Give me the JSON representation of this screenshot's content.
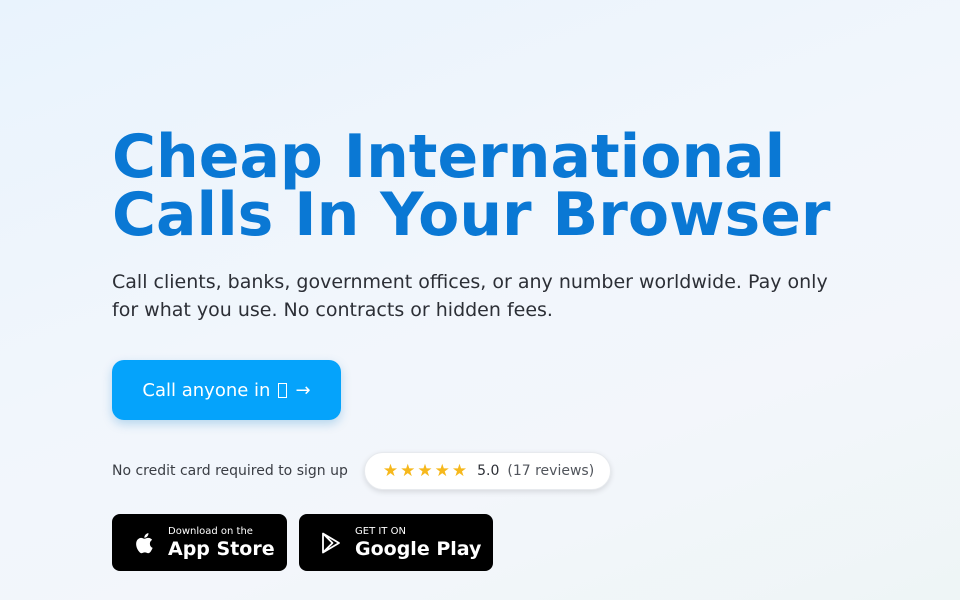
{
  "hero": {
    "title_line1": "Cheap International",
    "title_line2": "Calls In Your Browser",
    "subtitle": "Call clients, banks, government offices, or any number worldwide. Pay only for what you use. No contracts or hidden fees."
  },
  "cta": {
    "label": "Call anyone in",
    "arrow": "→"
  },
  "signup_note": "No credit card required to sign up",
  "rating": {
    "stars": 5,
    "star_glyph": "★",
    "score": "5.0",
    "reviews": "(17 reviews)"
  },
  "stores": {
    "apple": {
      "small": "Download on the",
      "big": "App Store",
      "icon": "apple-icon"
    },
    "google": {
      "small": "GET IT ON",
      "big": "Google Play",
      "icon": "play-icon"
    }
  },
  "colors": {
    "title": "#0a78d4",
    "cta_bg": "#05a3fb",
    "star": "#f6b81c",
    "store_bg": "#000000"
  }
}
